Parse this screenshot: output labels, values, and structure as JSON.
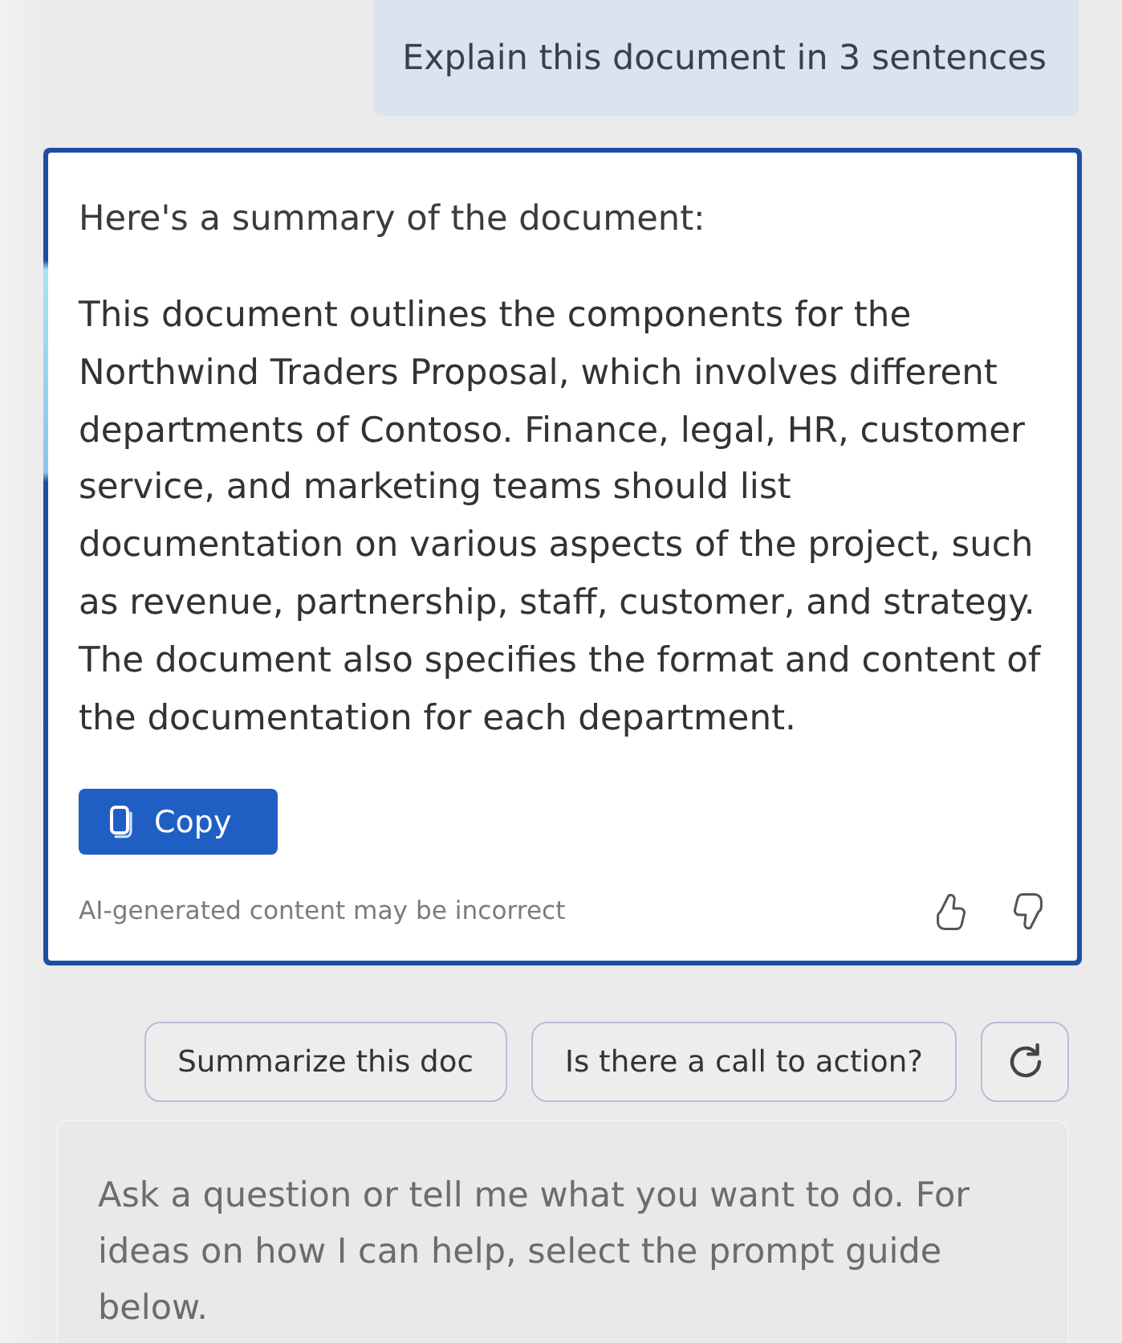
{
  "conversation": {
    "user_message": {
      "text": "Explain this document in 3 sentences"
    },
    "response": {
      "focused": true,
      "heading": "Here's a summary of the document:",
      "body": "This document outlines the components for the Northwind Traders Proposal, which involves different departments of Contoso. Finance, legal, HR, customer service, and marketing teams should list documentation on various aspects of the project, such as revenue, partnership, staff, customer, and strategy. The document also specifies the format and content of the documentation for each department.",
      "copy_button": "Copy",
      "disclaimer": "AI-generated content may be incorrect"
    }
  },
  "suggestions": [
    {
      "label": "Summarize this doc"
    },
    {
      "label": "Is there a call to action?"
    }
  ],
  "prompt_box": {
    "placeholder": "Ask a question or tell me what you want to do. For ideas on how I can help, select the prompt guide below."
  }
}
